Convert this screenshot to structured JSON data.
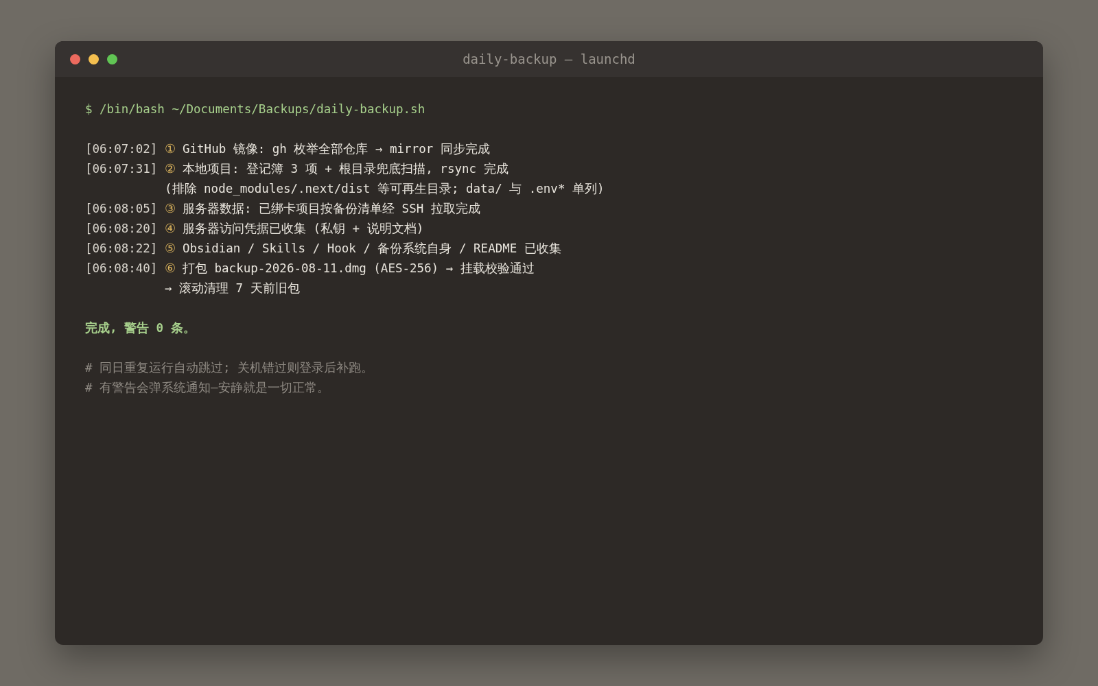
{
  "window": {
    "title": "daily-backup — launchd",
    "controls": [
      {
        "color": "#ec6a5e"
      },
      {
        "color": "#f4bf4f"
      },
      {
        "color": "#61c554"
      }
    ]
  },
  "blocks": [
    {
      "lines": [
        {
          "kind": "command",
          "text": "$ /bin/bash ~/Documents/Backups/daily-backup.sh"
        }
      ]
    },
    {
      "lines": [
        {
          "kind": "log",
          "time": "[06:07:02]",
          "marker": "①",
          "text": "GitHub 镜像: gh 枚举全部仓库 → mirror 同步完成"
        },
        {
          "kind": "log",
          "time": "[06:07:31]",
          "marker": "②",
          "text": "本地项目: 登记簿 3 项 + 根目录兜底扫描, rsync 完成"
        },
        {
          "kind": "continuation",
          "text": "(排除 node_modules/.next/dist 等可再生目录; data/ 与 .env* 单列)"
        },
        {
          "kind": "log",
          "time": "[06:08:05]",
          "marker": "③",
          "text": "服务器数据: 已绑卡项目按备份清单经 SSH 拉取完成"
        },
        {
          "kind": "log",
          "time": "[06:08:20]",
          "marker": "④",
          "text": "服务器访问凭据已收集 (私钥 + 说明文档)"
        },
        {
          "kind": "log",
          "time": "[06:08:22]",
          "marker": "⑤",
          "text": "Obsidian / Skills / Hook / 备份系统自身 / README 已收集"
        },
        {
          "kind": "log",
          "time": "[06:08:40]",
          "marker": "⑥",
          "text": "打包 backup-2026-08-11.dmg (AES-256) → 挂载校验通过"
        },
        {
          "kind": "continuation",
          "text": "→ 滚动清理 7 天前旧包"
        }
      ]
    },
    {
      "lines": [
        {
          "kind": "success",
          "text": "完成, 警告 0 条。"
        }
      ]
    },
    {
      "lines": [
        {
          "kind": "comment",
          "text": "# 同日重复运行自动跳过; 关机错过则登录后补跑。"
        },
        {
          "kind": "comment",
          "text": "# 有警告会弹系统通知—安静就是一切正常。"
        }
      ]
    }
  ]
}
